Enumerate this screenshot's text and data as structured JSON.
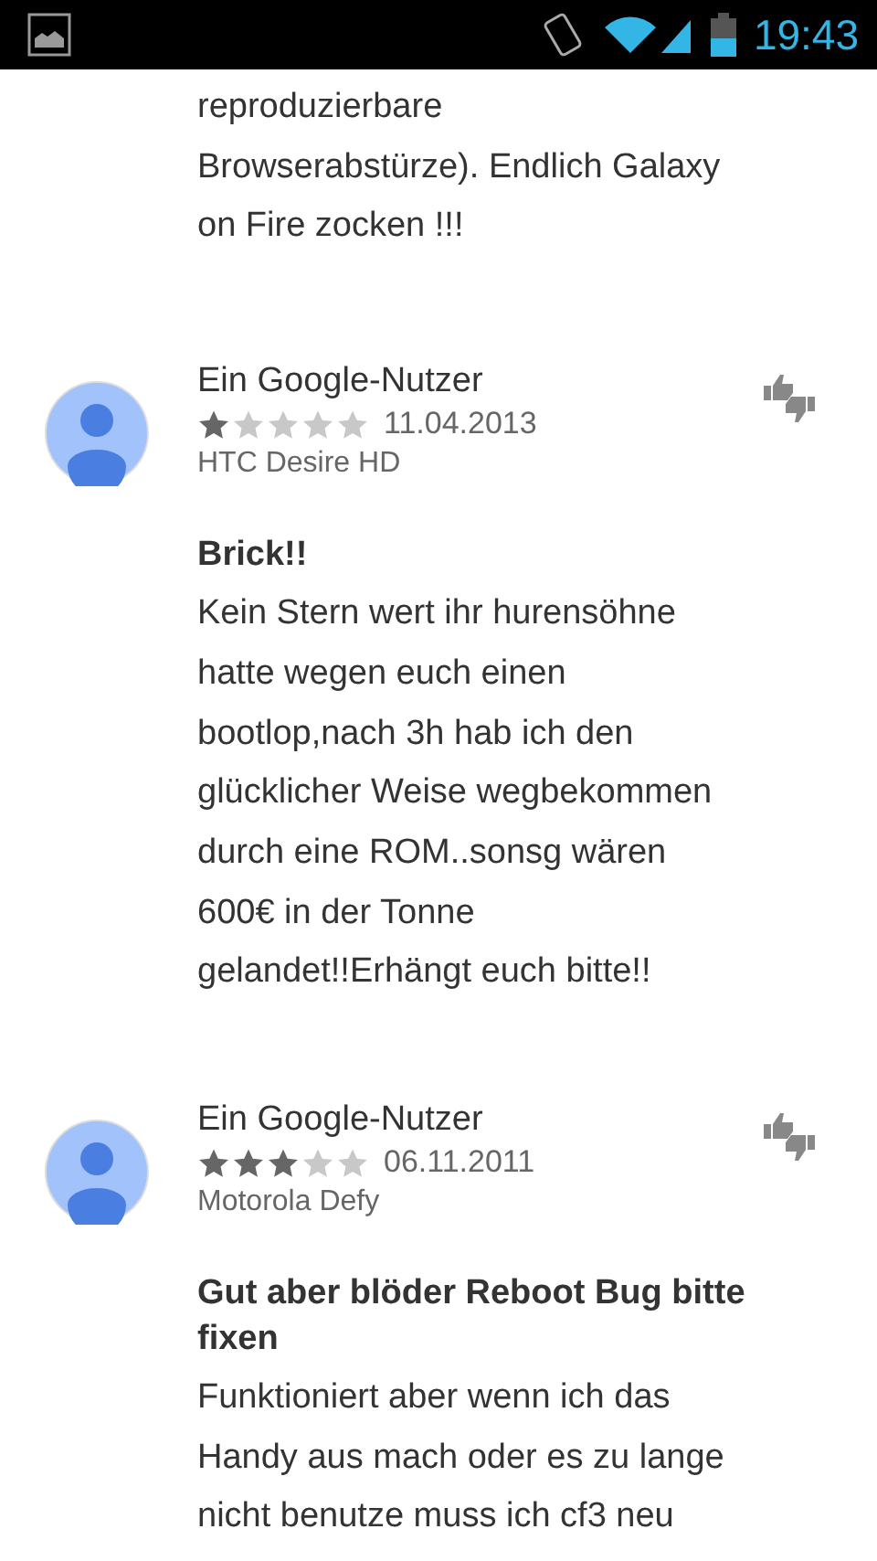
{
  "status_bar": {
    "time": "19:43"
  },
  "top_review": {
    "body_lines": [
      "reproduzierbare",
      "Browserabstürze). Endlich Galaxy",
      "on Fire zocken !!!"
    ]
  },
  "reviews": [
    {
      "author": "Ein Google-Nutzer",
      "stars": 1,
      "date": "11.04.2013",
      "device": "HTC Desire HD",
      "title_lines": [
        "Brick!!"
      ],
      "body_lines": [
        "Kein Stern wert ihr hurensöhne",
        "hatte wegen euch einen",
        "bootlop,nach 3h hab ich den",
        "glücklicher Weise wegbekommen",
        "durch eine ROM..sonsg wären",
        "600€ in der Tonne",
        "gelandet!!Erhängt euch bitte!!"
      ]
    },
    {
      "author": "Ein Google-Nutzer",
      "stars": 3,
      "date": "06.11.2011",
      "device": "Motorola Defy",
      "title_lines": [
        "Gut aber blöder Reboot Bug bitte",
        "fixen"
      ],
      "body_lines": [
        "Funktioniert aber wenn ich das",
        "Handy aus mach oder es zu lange",
        "nicht benutze muss ich cf3 neu"
      ]
    }
  ]
}
